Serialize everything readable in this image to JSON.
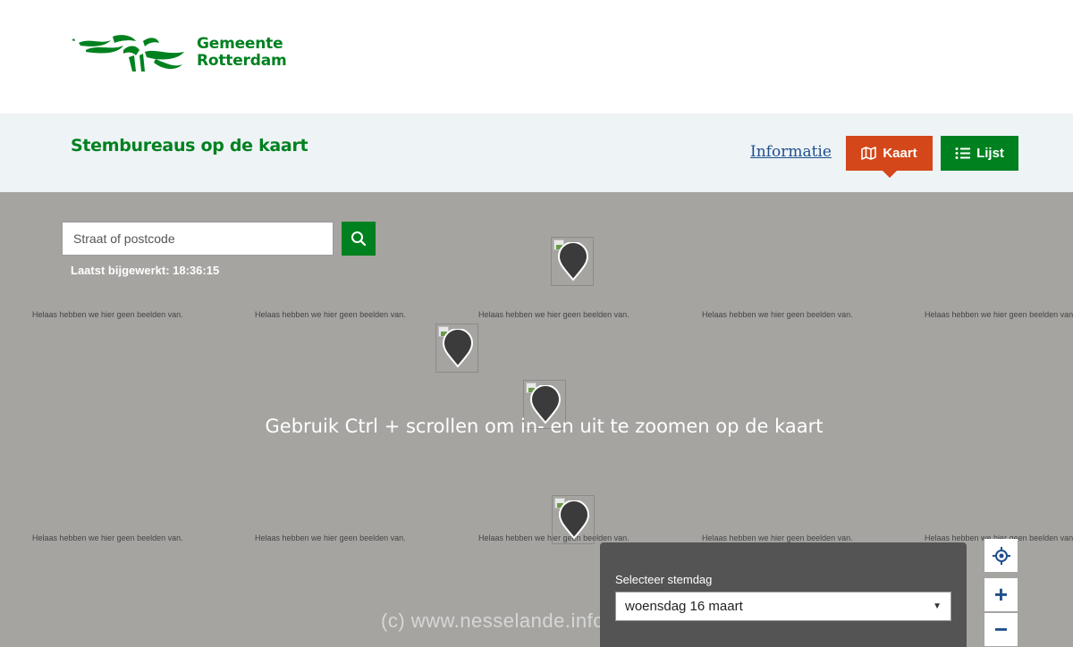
{
  "header": {
    "logo_line1": "Gemeente",
    "logo_line2": "Rotterdam",
    "brand_color": "#00811f"
  },
  "subbar": {
    "title": "Stembureaus op de kaart",
    "info_link": "Informatie",
    "kaart_label": "Kaart",
    "lijst_label": "Lijst",
    "kaart_icon": "map-icon",
    "lijst_icon": "list-icon",
    "kaart_color": "#d4471a"
  },
  "map": {
    "search_placeholder": "Straat of postcode",
    "search_icon": "search-icon",
    "last_updated": "Laatst bijgewerkt: 18:36:15",
    "tile_message": "Helaas hebben we hier geen beelden van.",
    "ctrl_hint": "Gebruik Ctrl + scrollen om in- en uit te zoomen op de kaart",
    "watermark": "(c)  www.nesselande.info",
    "controls": {
      "locate_icon": "crosshair-icon",
      "zoom_in": "+",
      "zoom_out": "−"
    }
  },
  "day_panel": {
    "label": "Selecteer stemdag",
    "selected": "woensdag 16 maart"
  }
}
